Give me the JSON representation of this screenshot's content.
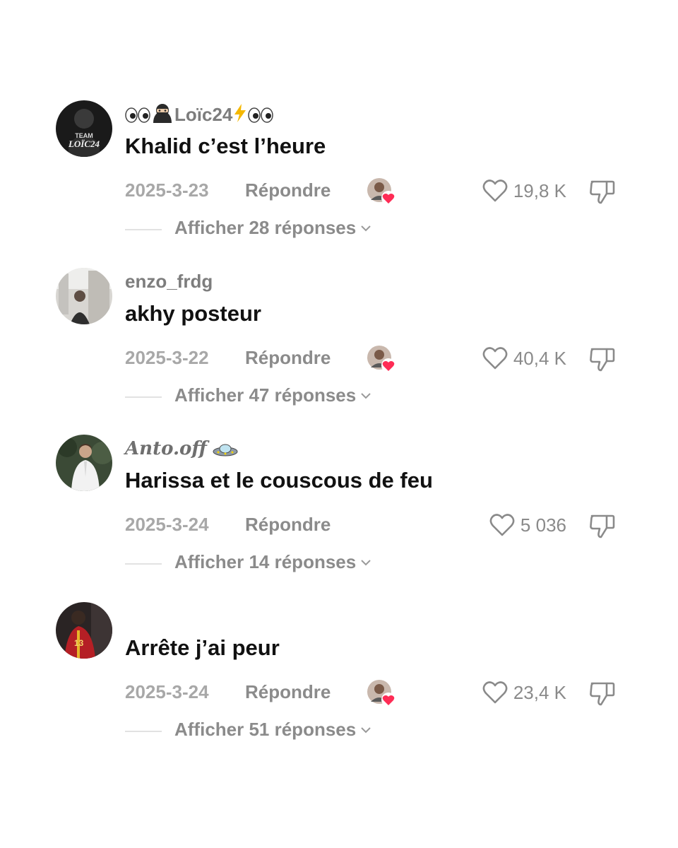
{
  "comments": [
    {
      "username": "Loïc24",
      "avatar_text_1": "TEAM",
      "avatar_text_2": "LOÏC24",
      "text": "Khalid c’est l’heure",
      "date": "2025-3-23",
      "reply_label": "Répondre",
      "likes": "19,8 K",
      "view_replies": "Afficher 28 réponses",
      "creator_liked": true
    },
    {
      "username": "enzo_frdg",
      "text": "akhy posteur",
      "date": "2025-3-22",
      "reply_label": "Répondre",
      "likes": "40,4 K",
      "view_replies": "Afficher 47 réponses",
      "creator_liked": true
    },
    {
      "username": "Anto.off",
      "text": "Harissa et le couscous de feu",
      "date": "2025-3-24",
      "reply_label": "Répondre",
      "likes": "5 036",
      "view_replies": "Afficher 14 réponses",
      "creator_liked": false
    },
    {
      "username": "",
      "text": "Arrête j’ai peur",
      "date": "2025-3-24",
      "reply_label": "Répondre",
      "likes": "23,4 K",
      "view_replies": "Afficher 51 réponses",
      "creator_liked": true
    }
  ],
  "colors": {
    "meta_gray": "#a8a8a8",
    "label_gray": "#8b8b8b",
    "text_black": "#111111",
    "creator_heart": "#fe2c55"
  },
  "icons": {
    "like": "heart-outline-icon",
    "dislike": "thumbs-down-icon",
    "expand": "chevron-down-icon",
    "creator_like": "creator-heart-badge-icon"
  }
}
